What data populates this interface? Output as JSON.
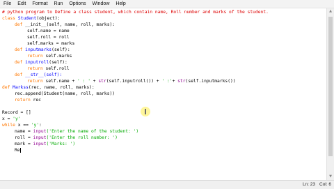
{
  "menu": [
    "File",
    "Edit",
    "Format",
    "Run",
    "Options",
    "Window",
    "Help"
  ],
  "code": {
    "line1": "# python program to Define a class student, which contain name, Roll number and marks of the student.",
    "line2_kw": "class",
    "line2_name": "Student",
    "line2_rest": "(object):",
    "line3_kw": "def",
    "line3_rest": " __init__(self, name, roll, marks):",
    "line4": "self.name = name",
    "line5": "self.roll = roll",
    "line6": "self.marks = marks",
    "line7_kw": "def",
    "line7_name": " inputmarks",
    "line7_rest": "(self):",
    "line8_kw": "return",
    "line8_rest": " self.marks",
    "line9_kw": "def",
    "line9_name": " inputroll",
    "line9_rest": "(self):",
    "line10_kw": "return",
    "line10_rest": " self.roll",
    "line11_kw": "def",
    "line11_rest": " __str__(self):",
    "line12_kw": "return",
    "line12_rest_a": " self.name + ",
    "line12_s1": "' : '",
    "line12_rest_b": " + ",
    "line12_bi1": "str",
    "line12_rest_c": "(self.inputroll()) +",
    "line12_s2": "' :'",
    "line12_rest_d": "+ ",
    "line12_bi2": "str",
    "line12_rest_e": "(self.inputmarks())",
    "line13_kw": "def",
    "line13_name": " Markss",
    "line13_rest": "(rec, name, roll, marks):",
    "line14": "rec.append(Student(name, roll, marks))",
    "line15_kw": "return",
    "line15_rest": " rec",
    "line16": "",
    "line17": "Record = []",
    "line18_a": "x = ",
    "line18_s": "'y'",
    "line19_kw": "while",
    "line19_a": " x == ",
    "line19_s": "'y'",
    "line19_b": ":",
    "line20_a": "name = ",
    "line20_bi": "input",
    "line20_s": "('Enter the name of the student: ')",
    "line21_a": "roll = ",
    "line21_bi": "input",
    "line21_s": "('Enter the roll number: ')",
    "line22_a": "mark = ",
    "line22_bi": "input",
    "line22_s": "('Marks: ')",
    "line23": "Re"
  },
  "status": {
    "line": "Ln: 23",
    "col": "Col: 6"
  },
  "colors": {
    "keyword": "#ff7700",
    "comment": "#dd0000",
    "string": "#00aa00",
    "builtin": "#900090",
    "defname": "#0000ff"
  }
}
